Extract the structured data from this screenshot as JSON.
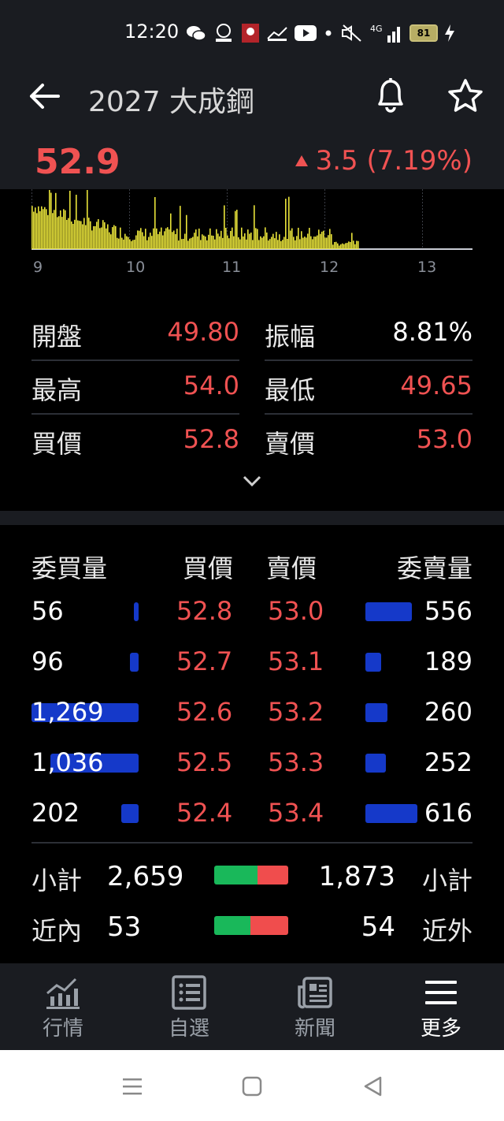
{
  "status_bar": {
    "time": "12:20",
    "icons": [
      "wechat-icon",
      "gomaji-icon",
      "app-icon",
      "signal-bars-icon",
      "youtube-icon",
      "dot-icon",
      "mute-icon",
      "4g-signal-icon"
    ],
    "network_label": "4G",
    "battery": "81"
  },
  "header": {
    "title": "2027 大成鋼",
    "price": "52.9",
    "change": "3.5 (7.19%)",
    "colors": {
      "up": "#f05252",
      "bg": "#1a1c21"
    }
  },
  "chart_data": {
    "type": "bar",
    "xlabel": "",
    "ylabel": "",
    "x_ticks": [
      "9",
      "10",
      "11",
      "12",
      "13"
    ],
    "series_color": "#e8e33a",
    "grid": true
  },
  "stats": {
    "rows": [
      {
        "label": "開盤",
        "value": "49.80",
        "label2": "振幅",
        "value2": "8.81%"
      },
      {
        "label": "最高",
        "value": "54.0",
        "label2": "最低",
        "value2": "49.65"
      },
      {
        "label": "買價",
        "value": "52.8",
        "label2": "賣價",
        "value2": "53.0"
      }
    ]
  },
  "order_book": {
    "headers": {
      "bid_qty": "委買量",
      "bid_price": "買價",
      "ask_price": "賣價",
      "ask_qty": "委賣量"
    },
    "rows": [
      {
        "bid_qty": "56",
        "bid_price": "52.8",
        "ask_price": "53.0",
        "ask_qty": "556",
        "bid_ratio": 0.04,
        "ask_ratio": 0.45
      },
      {
        "bid_qty": "96",
        "bid_price": "52.7",
        "ask_price": "53.1",
        "ask_qty": "189",
        "bid_ratio": 0.08,
        "ask_ratio": 0.15
      },
      {
        "bid_qty": "1,269",
        "bid_price": "52.6",
        "ask_price": "53.2",
        "ask_qty": "260",
        "bid_ratio": 1.0,
        "ask_ratio": 0.21
      },
      {
        "bid_qty": "1,036",
        "bid_price": "52.5",
        "ask_price": "53.3",
        "ask_qty": "252",
        "bid_ratio": 0.82,
        "ask_ratio": 0.2
      },
      {
        "bid_qty": "202",
        "bid_price": "52.4",
        "ask_price": "53.4",
        "ask_qty": "616",
        "bid_ratio": 0.16,
        "ask_ratio": 0.5
      }
    ],
    "subtotal": {
      "label": "小計",
      "bid": "2,659",
      "ask": "1,873",
      "label2": "小計",
      "green_ratio": 0.59
    },
    "near": {
      "label": "近內",
      "bid": "53",
      "ask": "54",
      "label2": "近外",
      "green_ratio": 0.49
    }
  },
  "nav": {
    "items": [
      {
        "label": "行情",
        "icon": "chart-icon"
      },
      {
        "label": "自選",
        "icon": "watchlist-icon"
      },
      {
        "label": "新聞",
        "icon": "news-icon"
      },
      {
        "label": "更多",
        "icon": "menu-icon"
      }
    ]
  }
}
